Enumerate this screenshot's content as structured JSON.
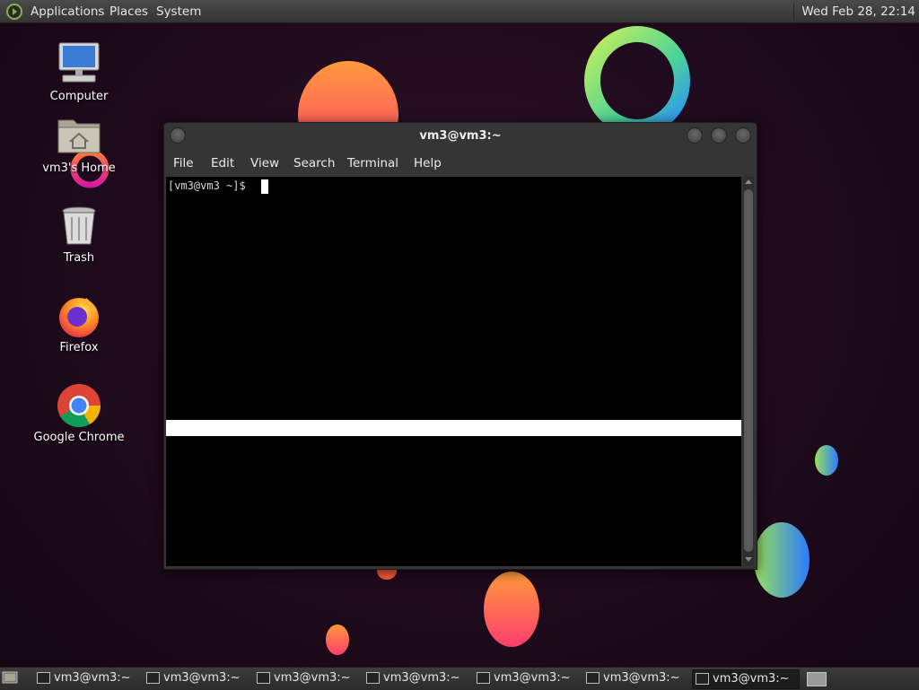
{
  "top_panel": {
    "menus": [
      "Applications",
      "Places",
      "System"
    ],
    "clock": "Wed Feb 28, 22:14"
  },
  "desktop_icons": [
    {
      "label": "Computer",
      "icon": "computer-icon"
    },
    {
      "label": "vm3's Home",
      "icon": "home-folder-icon"
    },
    {
      "label": "Trash",
      "icon": "trash-icon"
    },
    {
      "label": "Firefox",
      "icon": "firefox-icon"
    },
    {
      "label": "Google Chrome",
      "icon": "chrome-icon"
    }
  ],
  "terminal": {
    "title": "vm3@vm3:~",
    "menu": [
      "File",
      "Edit",
      "View",
      "Search",
      "Terminal",
      "Help"
    ],
    "prompt": "[vm3@vm3 ~]$"
  },
  "taskbar": {
    "tasks": [
      "vm3@vm3:~",
      "vm3@vm3:~",
      "vm3@vm3:~",
      "vm3@vm3:~",
      "vm3@vm3:~",
      "vm3@vm3:~",
      "vm3@vm3:~"
    ]
  },
  "colors": {
    "panel": "#3f3f3f",
    "desktop_bg": "#1e0a1c",
    "terminal_bg": "#000000"
  }
}
